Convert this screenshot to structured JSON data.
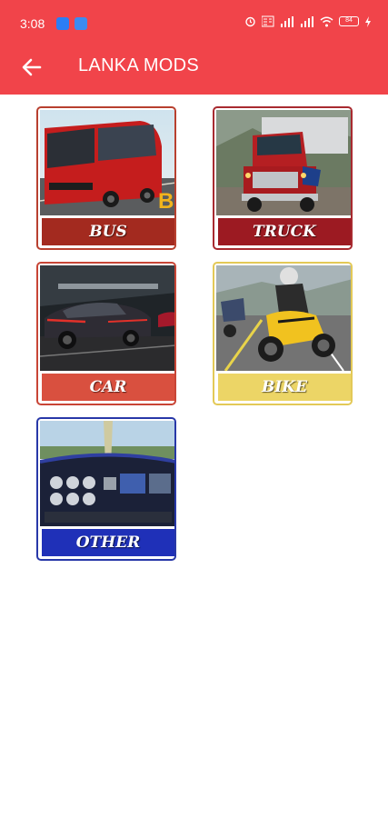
{
  "status": {
    "time": "3:08",
    "battery": "84"
  },
  "toolbar": {
    "title": "LANKA MODS"
  },
  "categories": [
    {
      "label": "BUS",
      "color": "#a32a1f",
      "border": "#b8402f"
    },
    {
      "label": "TRUCK",
      "color": "#9c1a22",
      "border": "#a82a30"
    },
    {
      "label": "CAR",
      "color": "#d9503f",
      "border": "#c84536"
    },
    {
      "label": "BIKE",
      "color": "#ecd566",
      "border": "#e3c957"
    },
    {
      "label": "OTHER",
      "color": "#1f30b8",
      "border": "#2838a8"
    }
  ]
}
